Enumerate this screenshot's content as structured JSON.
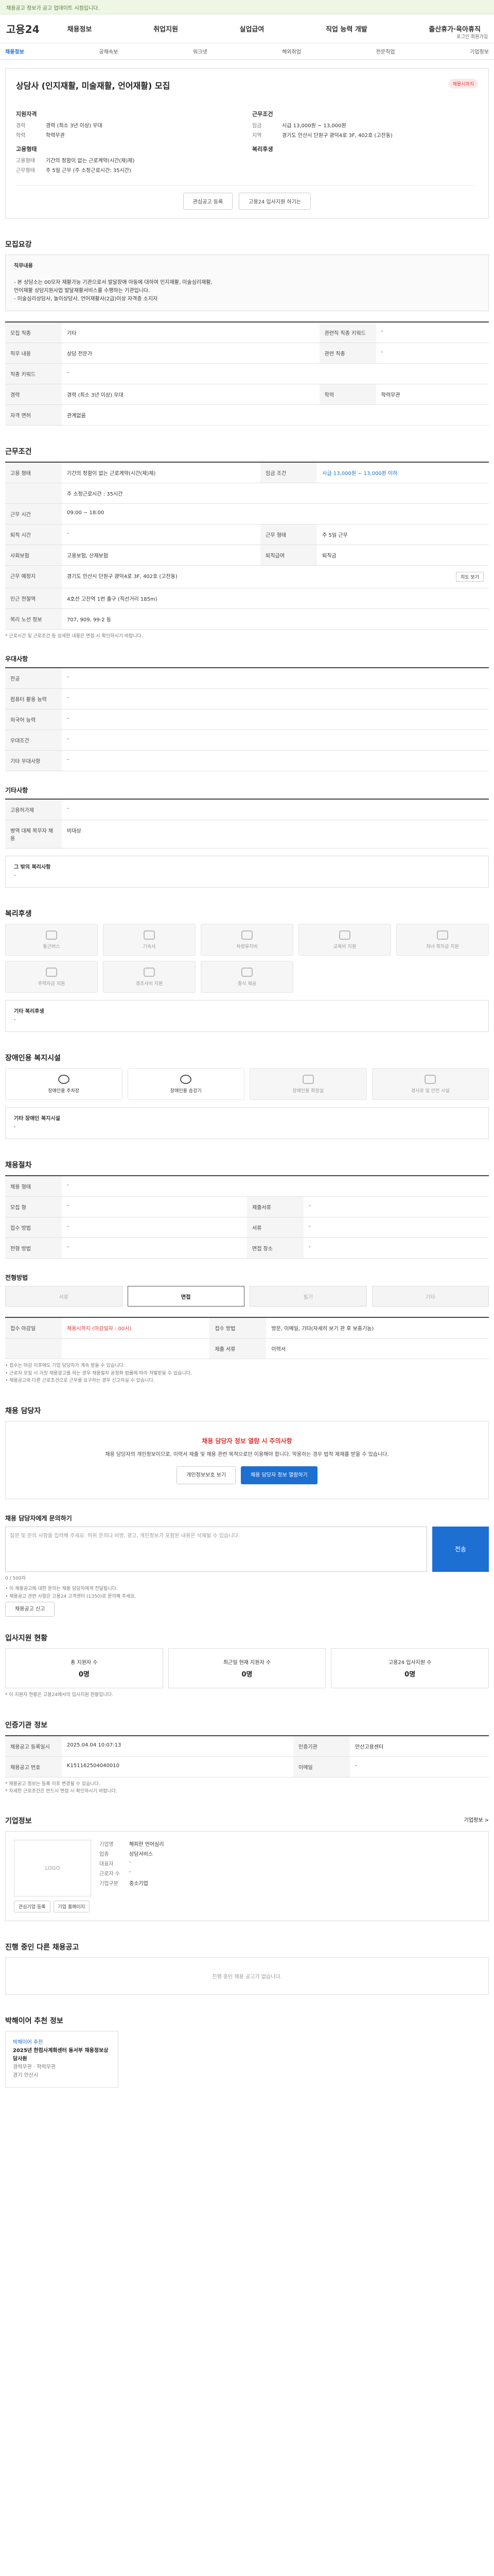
{
  "alert": "채용공고 정보가 공고 업데이트 시점입니다.",
  "header": {
    "logo": "고용24",
    "nav": [
      "채용정보",
      "취업지원",
      "실업급여",
      "직업 능력 개발",
      "출산휴가·육아휴직"
    ],
    "util": "로그인  회원가입",
    "subtabs": [
      "채용정보",
      "공채속보",
      "워크넷",
      "해외취업",
      "전문직업",
      "기업정보"
    ]
  },
  "job": {
    "title": "상담사 (인지재활, 미술재활, 언어재활) 모집",
    "badge": "채용시까지",
    "left_heading": "지원자격",
    "left": [
      {
        "k": "경력",
        "v": "경력 (최소 3년 이상) 우대"
      },
      {
        "k": "학력",
        "v": "학력무관"
      }
    ],
    "left_heading2": "고용형태",
    "left2": [
      {
        "k": "고용형태",
        "v": "기간의 정함이 없는 근로계약(시간(제)제)"
      },
      {
        "k": "근무형태",
        "v": "주 5일 근무 (주 소정근로시간: 35시간)"
      }
    ],
    "right_heading": "근무조건",
    "right": [
      {
        "k": "임금",
        "v": "시급 13,000원 ~ 13,000원"
      },
      {
        "k": "지역",
        "v": "경기도 안산시 단원구 광덕4로 3F, 402호 (고잔동)"
      }
    ],
    "right_heading2": "복리후생",
    "buttons": {
      "apply": "관심공고 등록",
      "share": "고용24 입사지원 하기는"
    }
  },
  "sections": {
    "recruit": "모집요강",
    "duty_title": "직무내용",
    "duty_lines": [
      "- 본 상담소는 00모자 재활가능 기관으로서 발달장애 아동에 대하여 인지재활, 미술심리재활,",
      "  언어재활 상담지원사업 발달재활서비스를 수행하는 기관입니다.",
      "- 미술심리상담사, 놀이상담사, 언어재활사(2급)이상 자격증 소지자"
    ],
    "recruit_rows": [
      [
        {
          "k": "모집 직종",
          "v": "기타"
        },
        {
          "k": "관련직 직종 키워드",
          "v": "-"
        }
      ],
      [
        {
          "k": "직무 내용",
          "v": "상담 전문가"
        },
        {
          "k": "관련 직종",
          "v": "-"
        }
      ],
      [
        {
          "k": "직종 키워드",
          "v": "-"
        },
        {
          "k": "",
          "v": ""
        }
      ],
      [
        {
          "k": "경력",
          "v": "경력 (최소 3년 이상) 우대"
        },
        {
          "k": "학력",
          "v": "학력무관"
        }
      ],
      [
        {
          "k": "자격 면허",
          "v": "관계없음"
        },
        {
          "k": "",
          "v": ""
        }
      ]
    ],
    "work": "근무조건",
    "work_rows": [
      [
        {
          "k": "고용 형태",
          "v": "기간의 정함이 없는 근로계약(시간(제)제)"
        },
        {
          "k": "임금 조건",
          "v": "시급 13,000원 ~ 13,000원 이하"
        }
      ],
      [
        {
          "k": "",
          "v": "주 소정근로시간 : 35시간"
        },
        {
          "k": "",
          "v": ""
        }
      ],
      [
        {
          "k": "근무 시간",
          "v": "09:00 ~ 18:00"
        },
        {
          "k": "",
          "v": ""
        }
      ],
      [
        {
          "k": "퇴직 시간",
          "v": "-"
        },
        {
          "k": "근무 형태",
          "v": "주 5일 근무"
        }
      ],
      [
        {
          "k": "사회보험",
          "v": "고용보험, 산재보험"
        },
        {
          "k": "퇴직급여",
          "v": "퇴직금"
        }
      ],
      [
        {
          "k": "근무 예정지",
          "v": "경기도 안산시 단원구 광덕4로 3F, 402호 (고잔동)"
        },
        {
          "k": "",
          "v": ""
        }
      ],
      [
        {
          "k": "인근 전철역",
          "v": "4호선 고잔역 1번 출구 (직선거리 185m)"
        },
        {
          "k": "",
          "v": ""
        }
      ],
      [
        {
          "k": "복리 노선 정보",
          "v": "707, 909, 99-2 등"
        },
        {
          "k": "",
          "v": ""
        }
      ]
    ],
    "work_note": "* 근로시간 및 근로조건 등 상세한 내용은 면접 시 확인하시기 바랍니다.",
    "preferred": "우대사항",
    "pref_rows": [
      [
        "전공",
        "-"
      ],
      [
        "컴퓨터 활용 능력",
        "-"
      ],
      [
        "외국어 능력",
        "-"
      ],
      [
        "우대조건",
        "-"
      ],
      [
        "기타 우대사항",
        "-"
      ]
    ],
    "etc": "기타사항",
    "etc_rows": [
      [
        "고용허가제",
        "-"
      ],
      [
        "병역 대체 복무자 채용",
        "비대상"
      ]
    ],
    "etc_other": "그 밖의 복리사항",
    "etc_other_val": "-",
    "welfare": "복리후생",
    "welfare_tiles": [
      "통근버스",
      "기숙사",
      "차량유지비",
      "교육비 지원",
      "자녀 학자금 지원",
      "주택자금 지원",
      "경조사비 지원",
      "중식 제공",
      "",
      ""
    ],
    "welfare_other": "기타 복리후생",
    "welfare_other_val": "-",
    "disab": "장애인용 복지시설",
    "disab_tiles": [
      "장애인용 주차장",
      "장애인용 승강기",
      "장애인용 화장실",
      "경사로 및 안전 시설"
    ],
    "disab_other": "기타 장애인 복지시설",
    "disab_other_val": "-",
    "process": "채용절차",
    "process_rows": [
      [
        {
          "k": "채용 형태",
          "v": "-"
        },
        {
          "k": "",
          "v": ""
        }
      ],
      [
        {
          "k": "모집 형",
          "v": "-"
        },
        {
          "k": "제출서류",
          "v": "-"
        }
      ],
      [
        {
          "k": "접수 방법",
          "v": "-"
        },
        {
          "k": "서류",
          "v": "-"
        }
      ],
      [
        {
          "k": "전형 방법",
          "v": "-"
        },
        {
          "k": "면접 장소",
          "v": "-"
        }
      ]
    ],
    "steps_title": "전형방법",
    "steps": [
      "서류",
      "면접",
      "필기",
      "기타"
    ],
    "apply_rows": [
      [
        {
          "k": "접수 마감일",
          "v": "채용시까지 (마감일자 : 00시)"
        },
        {
          "k": "접수 방법",
          "v": "방문, 이메일, 기타(자세히 보기 관 후 보충기능)"
        }
      ],
      [
        {
          "k": "",
          "v": ""
        },
        {
          "k": "제출 서류",
          "v": "이력서"
        }
      ]
    ],
    "apply_notes": [
      "• 접수는 마감 이후에도 기업 담당자가 계속 받을 수 있습니다.",
      "• 근로자 모집 시 거짓 채용광고를 하는 경우 채용절차 공정화 법률에 따라 처벌받을 수 있습니다.",
      "• 채용공고와 다른 근로조건으로 근무를 요구하는 경우 신고하실 수 있습니다."
    ],
    "contact": "채용 담당자",
    "contact_callout_title": "채용 담당자 정보 열람 시 주의사항",
    "contact_callout_body": "채용 담당자의 개인정보이므로, 이력서 제출 및 채용 관련 목적으로만 이용해야 합니다. 악용하는 경우 법적 제재를 받을 수 있습니다.",
    "contact_btn1": "개인정보보호 보기",
    "contact_btn2": "채용 담당자 정보 열람하기",
    "inquiry": "채용 담당자에게 문의하기",
    "inquiry_placeholder": "질문 및 문의 사항을 입력해 주세요. 허위 문의나 비방, 광고, 개인정보가 포함된 내용은 삭제될 수 있습니다.",
    "inquiry_count": "0 / 500자",
    "inquiry_send": "전송",
    "inquiry_notes": [
      "• 이 채용공고에 대한 문의는 채용 담당자에게 전달됩니다.",
      "• 채용공고 관련 사항은 고용24 고객센터 (1350)로 문의해 주세요."
    ],
    "inquiry_btn": "채용공고 신고",
    "applicants": "입사지원 현황",
    "applicant_stats": [
      {
        "label": "총 지원자 수",
        "value": "0명"
      },
      {
        "label": "최근일 현재 지원자 수",
        "value": "0명"
      },
      {
        "label": "고용24 입사지원 수",
        "value": "0명"
      }
    ],
    "applicant_note": "* 이 지원자 현황은 고용24에서의 입사지원 현황입니다.",
    "info": "인증기관 정보",
    "info_rows": [
      [
        {
          "k": "채용공고 등록일시",
          "v": "2025.04.04 10:07:13"
        },
        {
          "k": "인증기관",
          "v": "안산고용센터"
        }
      ],
      [
        {
          "k": "채용공고 번호",
          "v": "K151162504040010"
        },
        {
          "k": "이메일",
          "v": "-"
        }
      ]
    ],
    "info_notes": [
      "* 채용공고 정보는 등록 이후 변경될 수 있습니다.",
      "* 자세한 근로조건은 반드시 면접 시 확인하시기 바랍니다."
    ],
    "company": "기업정보",
    "company_more": "기업정보 >",
    "company_logo": "LOGO",
    "company_rows": [
      {
        "k": "기업명",
        "v": "해피한 언어심리"
      },
      {
        "k": "업종",
        "v": "상담서비스"
      },
      {
        "k": "대표자",
        "v": "-"
      },
      {
        "k": "근로자 수",
        "v": "-"
      },
      {
        "k": "기업구분",
        "v": "중소기업"
      }
    ],
    "company_btn1": "관심기업 등록",
    "company_btn2": "기업 홈페이지",
    "other_jobs": "진행 중인 다른 채용공고",
    "other_jobs_empty": "진행 중인 채용 공고가 없습니다.",
    "recommend": "박해이어 추천 정보",
    "recommend_card": {
      "tag": "박해이어 추천",
      "title": "2025년 한컴사계화센터 동서부 채용정보상담사원",
      "meta": "경력무관 · 학력무관",
      "place": "경기 안산시"
    }
  }
}
